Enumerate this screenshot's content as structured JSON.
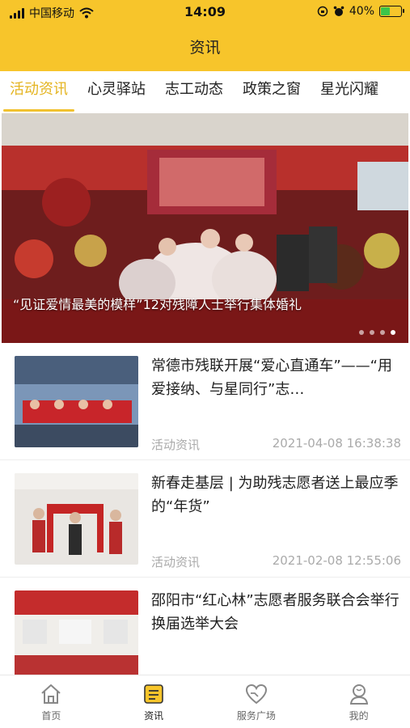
{
  "status_bar": {
    "carrier": "中国移动",
    "time": "14:09",
    "battery": "40%"
  },
  "header": {
    "title": "资讯"
  },
  "tabs": [
    {
      "label": "活动资讯",
      "active": true
    },
    {
      "label": "心灵驿站",
      "active": false
    },
    {
      "label": "志工动态",
      "active": false
    },
    {
      "label": "政策之窗",
      "active": false
    },
    {
      "label": "星光闪耀",
      "active": false
    }
  ],
  "banner": {
    "caption": "“见证爱情最美的模样”12对残障人士举行集体婚礼",
    "sign_text": "善 助 残",
    "slide_count": 4,
    "active_slide": 4
  },
  "news": [
    {
      "title": "常德市残联开展“爱心直通车”——“用爱接纳、与星同行”志…",
      "category": "活动资讯",
      "date": "2021-04-08 16:38:38"
    },
    {
      "title": "新春走基层 | 为助残志愿者送上最应季的“年货”",
      "category": "活动资讯",
      "date": "2021-02-08 12:55:06"
    },
    {
      "title": "邵阳市“红心林”志愿者服务联合会举行换届选举大会",
      "category": "",
      "date": ""
    }
  ],
  "bottom_nav": [
    {
      "label": "首页",
      "icon": "home-icon",
      "active": false
    },
    {
      "label": "资讯",
      "icon": "news-icon",
      "active": true
    },
    {
      "label": "服务广场",
      "icon": "service-heart-icon",
      "active": false
    },
    {
      "label": "我的",
      "icon": "profile-icon",
      "active": false
    }
  ],
  "colors": {
    "brand": "#f7c52b",
    "tab_active": "#e4b420",
    "meta_text": "#aaaaaa"
  }
}
